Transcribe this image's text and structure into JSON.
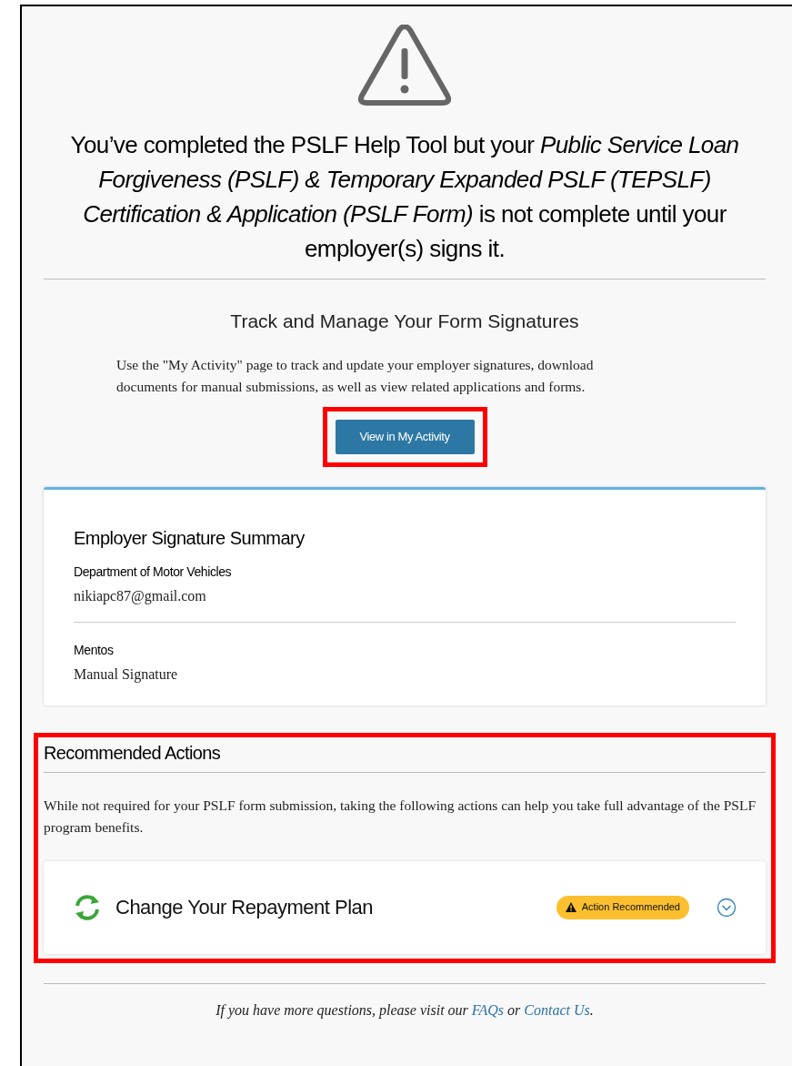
{
  "headline": "You’ve completed the PSLF Help Tool but your *Public Service Loan Forgiveness (PSLF) & Temporary Expanded PSLF (TEPSLF) Certification & Application (PSLF Form)* is not complete until your employer(s) signs it.",
  "track": {
    "title": "Track and Manage Your Form Signatures",
    "description": "Use the \"My Activity\" page to track and update your employer signatures, download documents for manual submissions, as well as view related applications and forms.",
    "button": "View in My Activity"
  },
  "summary": {
    "title": "Employer Signature Summary",
    "employers": [
      {
        "name": "Department of Motor Vehicles",
        "detail": "nikiapc87@gmail.com"
      },
      {
        "name": "Mentos",
        "detail": "Manual Signature"
      }
    ]
  },
  "recommended": {
    "title": "Recommended Actions",
    "description": "While not required for your PSLF form submission, taking the following actions can help you take full advantage of the PSLF program benefits.",
    "actions": [
      {
        "title": "Change Your Repayment Plan",
        "badge": "Action Recommended",
        "expanded": false
      }
    ]
  },
  "footer": [
    {
      "kind": "text",
      "text": "If you have more questions, please visit our "
    },
    {
      "kind": "link",
      "text": "FAQs"
    },
    {
      "kind": "text",
      "text": " or "
    },
    {
      "kind": "link",
      "text": "Contact Us"
    },
    {
      "kind": "text",
      "text": "."
    }
  ]
}
